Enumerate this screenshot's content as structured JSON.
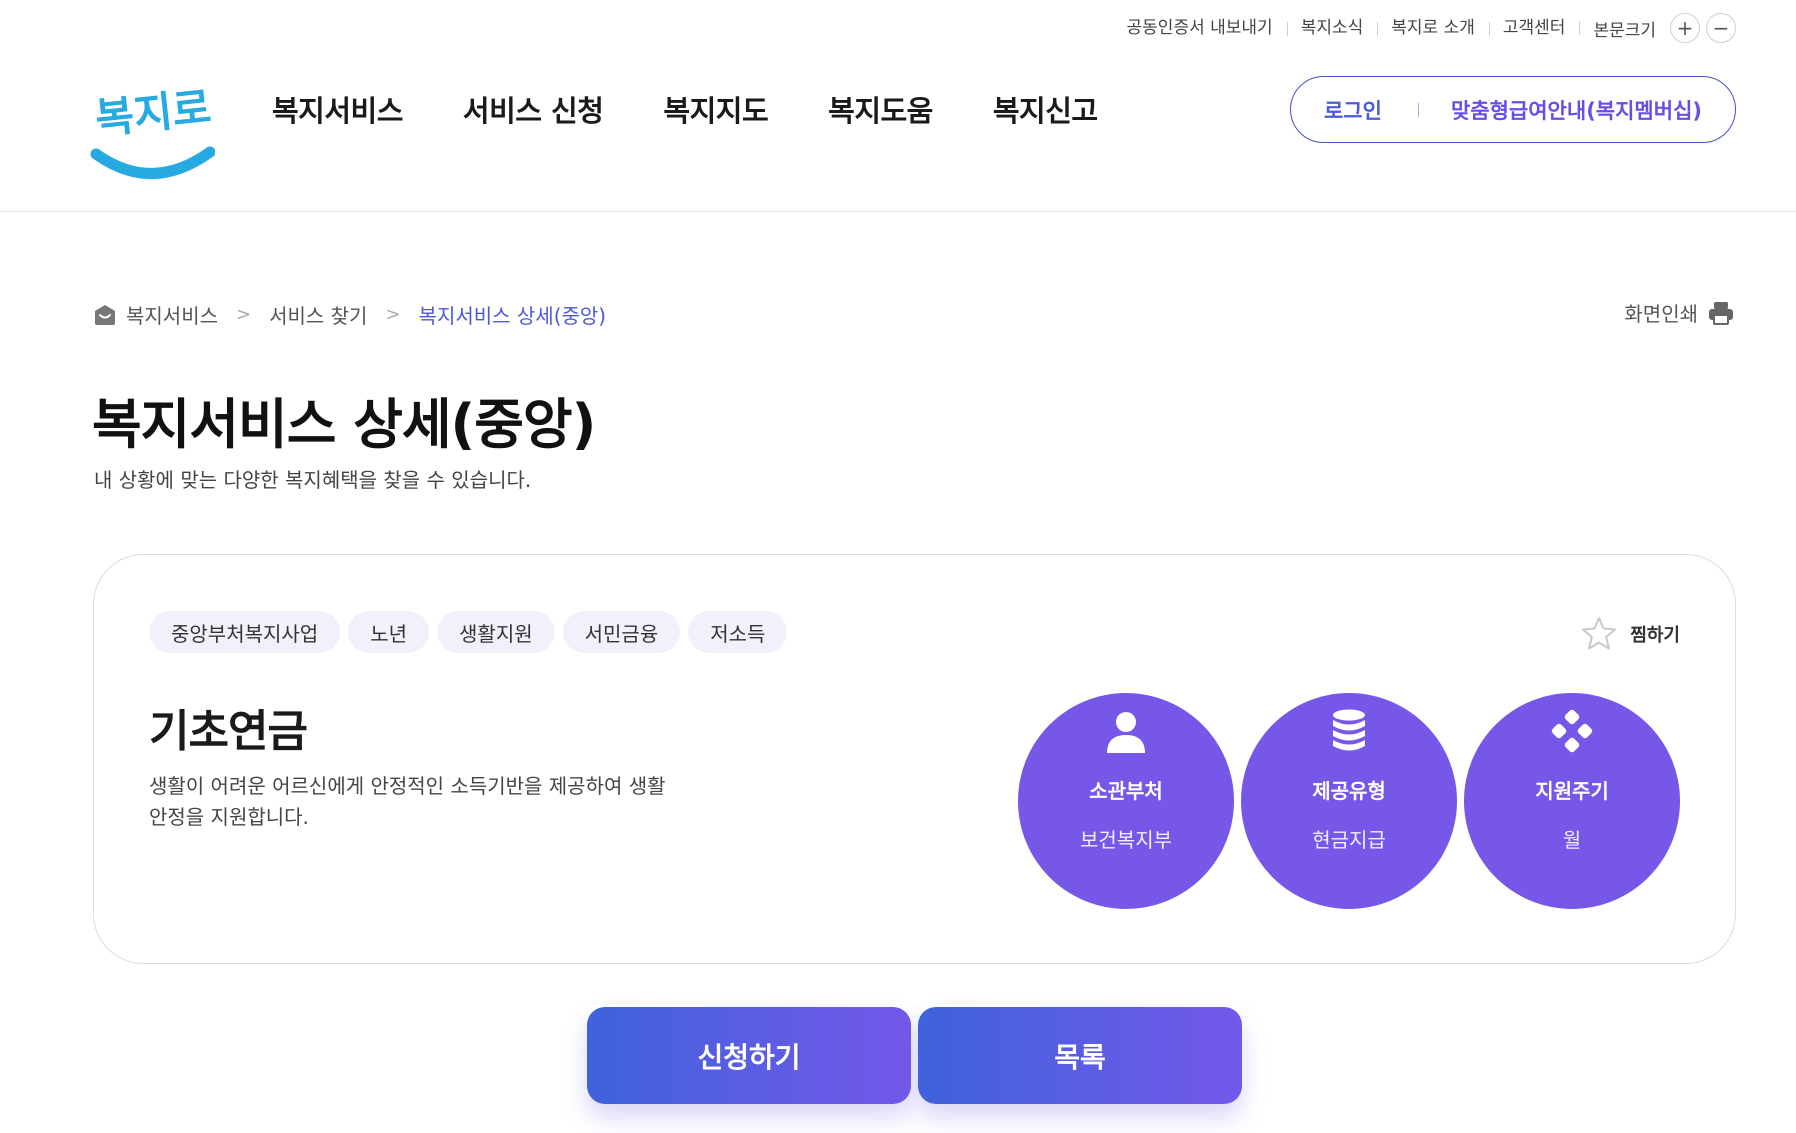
{
  "utility": {
    "links": [
      "공동인증서 내보내기",
      "복지소식",
      "복지로 소개",
      "고객센터"
    ],
    "font_size_label": "본문크기",
    "zoom_in": "+",
    "zoom_out": "−"
  },
  "header": {
    "logo_text": "복지로",
    "nav": [
      "복지서비스",
      "서비스 신청",
      "복지지도",
      "복지도움",
      "복지신고"
    ],
    "login": "로그인",
    "membership": "맞춤형급여안내(복지멤버십)"
  },
  "breadcrumb": {
    "items": [
      "복지서비스",
      "서비스 찾기"
    ],
    "current": "복지서비스 상세(중앙)",
    "separator": ">"
  },
  "print_label": "화면인쇄",
  "page": {
    "title": "복지서비스 상세(중앙)",
    "description": "내 상황에 맞는 다양한 복지혜택을 찾을 수 있습니다."
  },
  "service": {
    "tags": [
      "중앙부처복지사업",
      "노년",
      "생활지원",
      "서민금융",
      "저소득"
    ],
    "bookmark_label": "찜하기",
    "title": "기초연금",
    "description": "생활이 어려운 어르신에게 안정적인 소득기반을 제공하여 생활안정을 지원합니다.",
    "info": [
      {
        "icon": "person-icon",
        "label": "소관부처",
        "value": "보건복지부"
      },
      {
        "icon": "database-icon",
        "label": "제공유형",
        "value": "현금지급"
      },
      {
        "icon": "cycle-icon",
        "label": "지원주기",
        "value": "월"
      }
    ]
  },
  "actions": {
    "apply": "신청하기",
    "list": "목록"
  },
  "colors": {
    "brand_blue": "#4c5ad6",
    "brand_purple": "#7657e8",
    "tag_bg": "#f1f0fb",
    "logo_blue": "#27a9e1"
  }
}
